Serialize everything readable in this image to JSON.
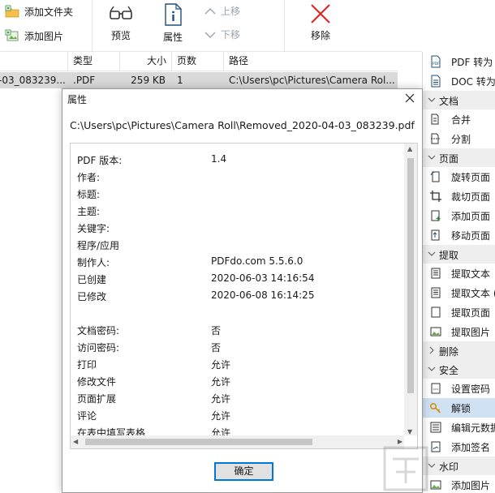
{
  "toolbar": {
    "add_folder": "添加文件夹",
    "add_image": "添加图片",
    "preview": "预览",
    "properties": "属性",
    "move_up": "上移",
    "move_down": "下移",
    "remove": "移除"
  },
  "table": {
    "headers": {
      "type": "类型",
      "size": "大小",
      "pages": "页数",
      "path": "路径"
    },
    "rows": [
      {
        "name": "-03_083239....",
        "type": ".PDF",
        "size": "259 KB",
        "pages": "1",
        "path": "C:\\Users\\pc\\Pictures\\Camera Rol..."
      }
    ]
  },
  "sidebar": {
    "top_items": [
      {
        "label": "PDF 转为",
        "icon": "pdf-doc-icon"
      },
      {
        "label": "DOC 转为",
        "icon": "doc-file-icon"
      }
    ],
    "groups": {
      "document": {
        "label": "文档",
        "items": [
          "合并",
          "分割"
        ]
      },
      "page": {
        "label": "页面",
        "items": [
          "旋转页面",
          "裁切页面",
          "添加页面",
          "移动页面"
        ]
      },
      "extract": {
        "label": "提取",
        "items": [
          "提取文本",
          "提取文本 (",
          "提取页面",
          "提取图片"
        ]
      },
      "delete": {
        "label": "删除"
      },
      "security": {
        "label": "安全",
        "items": [
          "设置密码",
          "解锁",
          "编辑元数据",
          "添加签名"
        ]
      },
      "watermark": {
        "label": "水印",
        "items": [
          "添加图片"
        ]
      }
    }
  },
  "dialog": {
    "title": "属性",
    "path": "C:\\Users\\pc\\Pictures\\Camera Roll\\Removed_2020-04-03_083239.pdf",
    "properties": [
      {
        "key": "PDF 版本:",
        "value": "1.4"
      },
      {
        "key": "作者:",
        "value": ""
      },
      {
        "key": "标题:",
        "value": ""
      },
      {
        "key": "主题:",
        "value": ""
      },
      {
        "key": "关键字:",
        "value": ""
      },
      {
        "key": "程序/应用",
        "value": ""
      },
      {
        "key": "制作人:",
        "value": "PDFdo.com  5.5.6.0"
      },
      {
        "key": "已创建",
        "value": "2020-06-03 14:16:54"
      },
      {
        "key": "已修改",
        "value": "2020-06-08 16:14:25"
      },
      {
        "key": "文档密码:",
        "value": "否"
      },
      {
        "key": "访问密码:",
        "value": "否"
      },
      {
        "key": "打印",
        "value": "允许"
      },
      {
        "key": "修改文件",
        "value": "允许"
      },
      {
        "key": "页面扩展",
        "value": "允许"
      },
      {
        "key": "评论",
        "value": "允许"
      },
      {
        "key": "在表中填写表格",
        "value": "允许"
      }
    ],
    "ok_label": "确定"
  },
  "colors": {
    "selected_row": "#d9d9d9",
    "sidebar_selected": "#cfe1f3",
    "group_header": "#eeeeee",
    "remove_red": "#e02020",
    "button_border": "#0078d7"
  }
}
